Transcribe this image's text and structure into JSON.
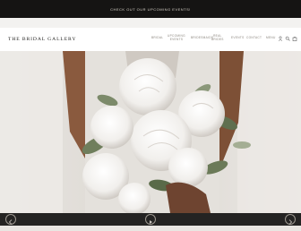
{
  "announcement": "CHECK OUT OUR UPCOMING EVENTS!",
  "brand": "THE BRIDAL GALLERY",
  "nav": {
    "bridal": "BRIDAL",
    "upcoming_events": [
      "UPCOMING",
      "EVENTS"
    ],
    "bridesmaids": "BRIDESMAIDS",
    "real_brides": [
      "REAL",
      "BRIDES"
    ],
    "events": "EVENTS",
    "contact": "CONTACT",
    "menu": "MENU"
  },
  "icons": [
    "user-icon",
    "search-icon",
    "bag-icon",
    "prev-arrow-icon",
    "play-icon",
    "next-arrow-icon"
  ],
  "colors": {
    "announcement_bg": "#151413",
    "header_bg": "#ffffff",
    "footer_bg": "#242322",
    "accent": "#8a857d"
  }
}
